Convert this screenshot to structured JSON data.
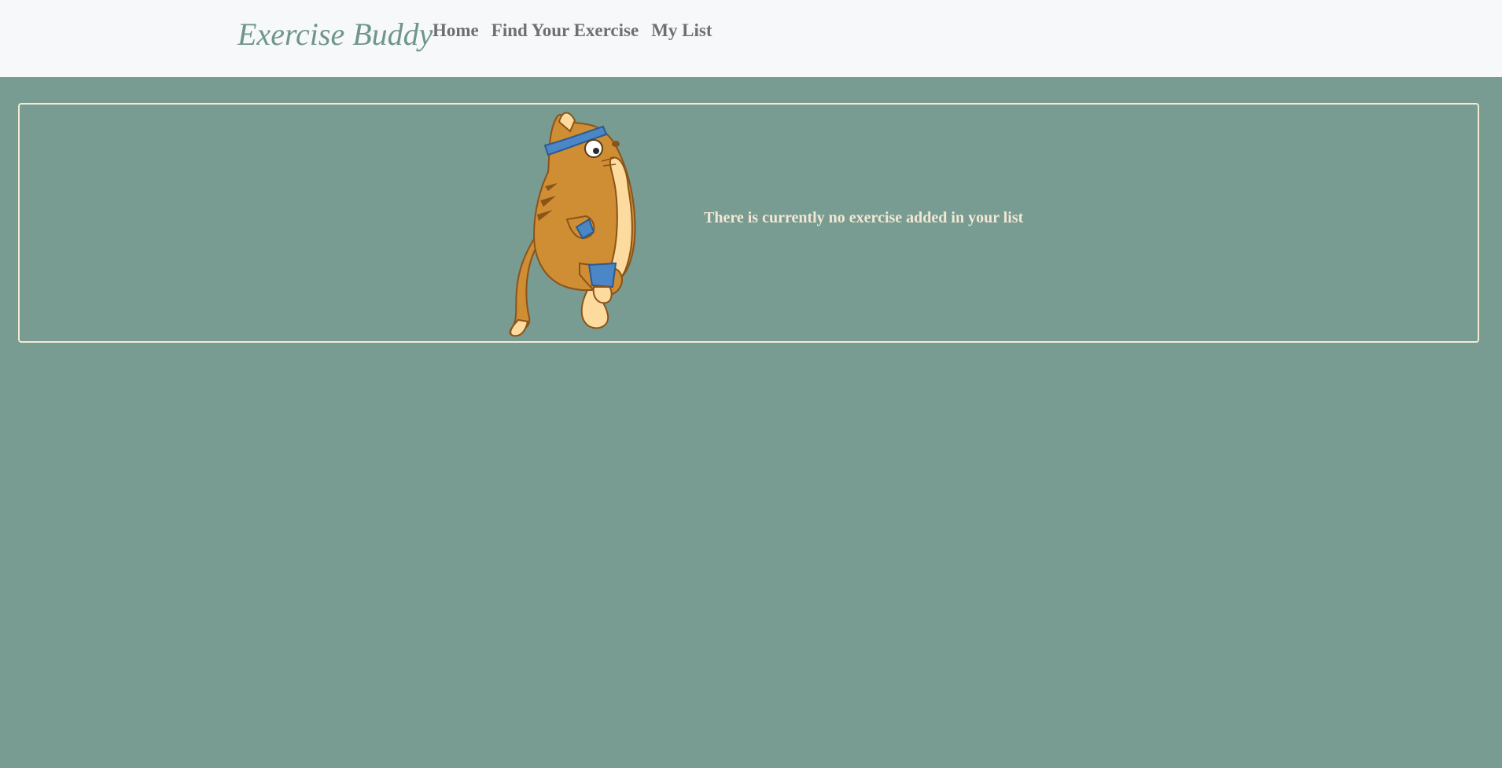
{
  "navbar": {
    "brand": "Exercise Buddy",
    "links": [
      {
        "label": "Home"
      },
      {
        "label": "Find Your Exercise"
      },
      {
        "label": "My List"
      }
    ]
  },
  "main": {
    "empty_message": "There is currently no exercise added in your list",
    "illustration": "exercising-cat-with-headband"
  },
  "colors": {
    "background": "#789b92",
    "navbar": "#f7f8fa",
    "brand": "#6e968b",
    "nav_link": "#6c6f73",
    "message": "#f3e8d4",
    "card_border": "#f3ead6"
  }
}
